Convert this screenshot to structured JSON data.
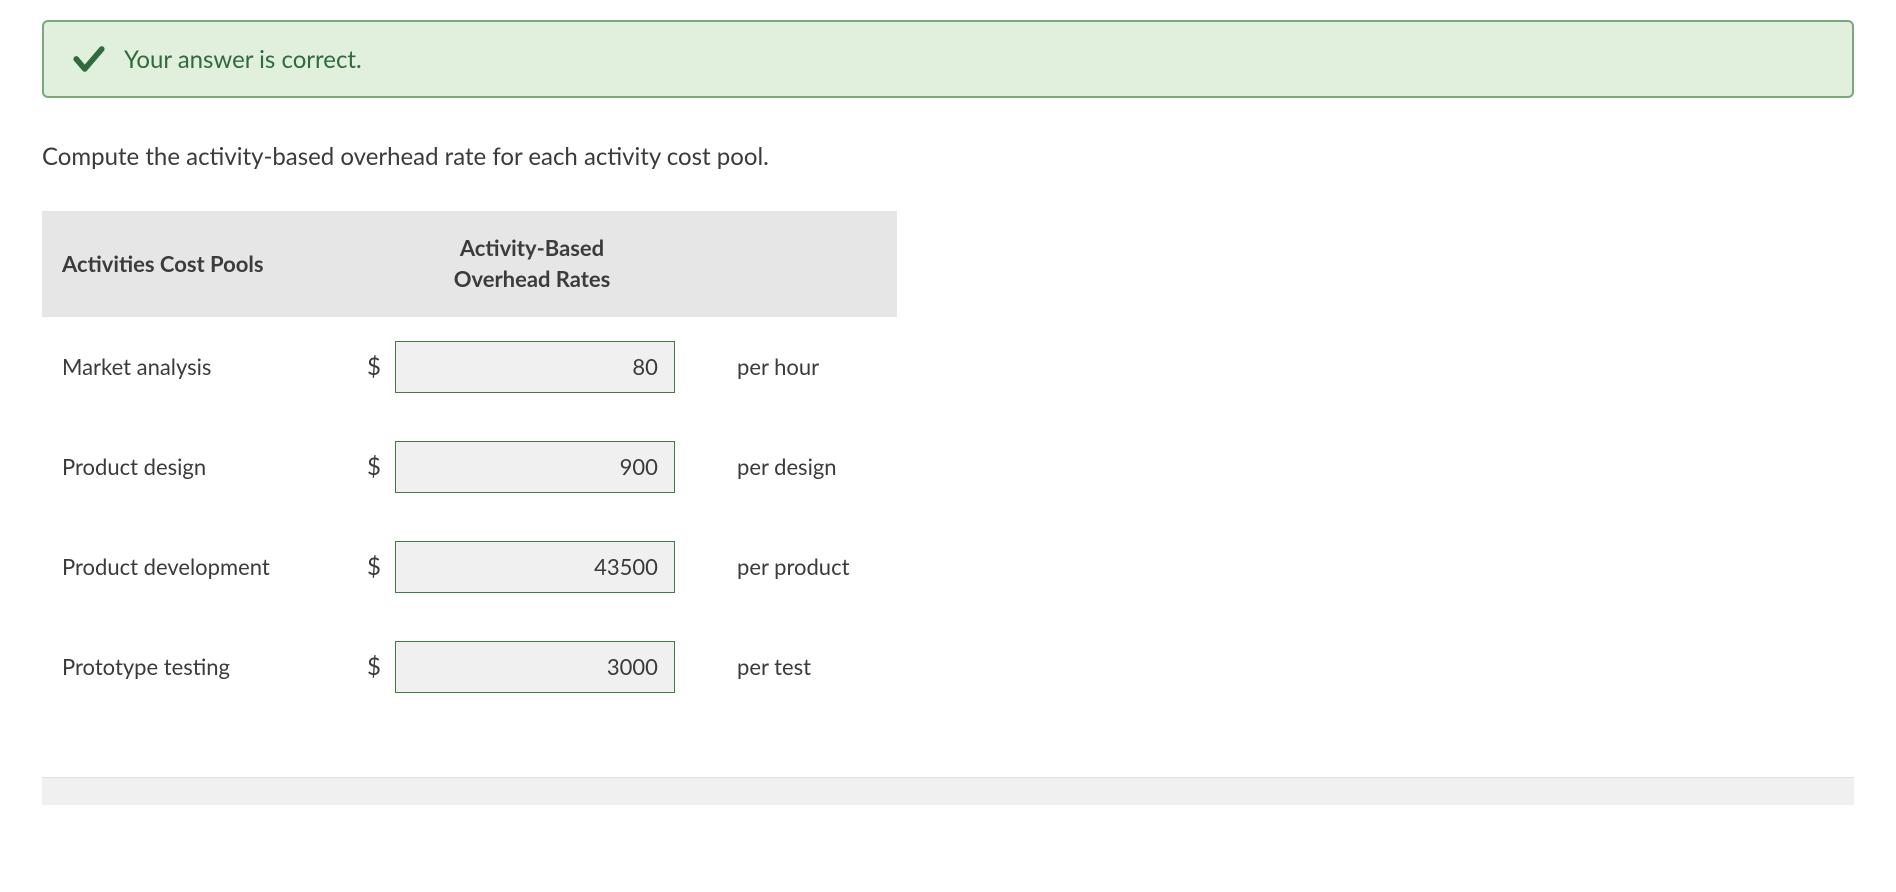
{
  "alert": {
    "message": "Your answer is correct."
  },
  "instruction": "Compute the activity-based overhead rate for each activity cost pool.",
  "table": {
    "headers": {
      "activities": "Activities Cost Pools",
      "rates_line1": "Activity-Based",
      "rates_line2": "Overhead Rates"
    },
    "currency_symbol": "$",
    "rows": [
      {
        "activity": "Market analysis",
        "value": "80",
        "unit": "per hour"
      },
      {
        "activity": "Product design",
        "value": "900",
        "unit": "per design"
      },
      {
        "activity": "Product development",
        "value": "43500",
        "unit": "per product"
      },
      {
        "activity": "Prototype testing",
        "value": "3000",
        "unit": "per test"
      }
    ]
  }
}
